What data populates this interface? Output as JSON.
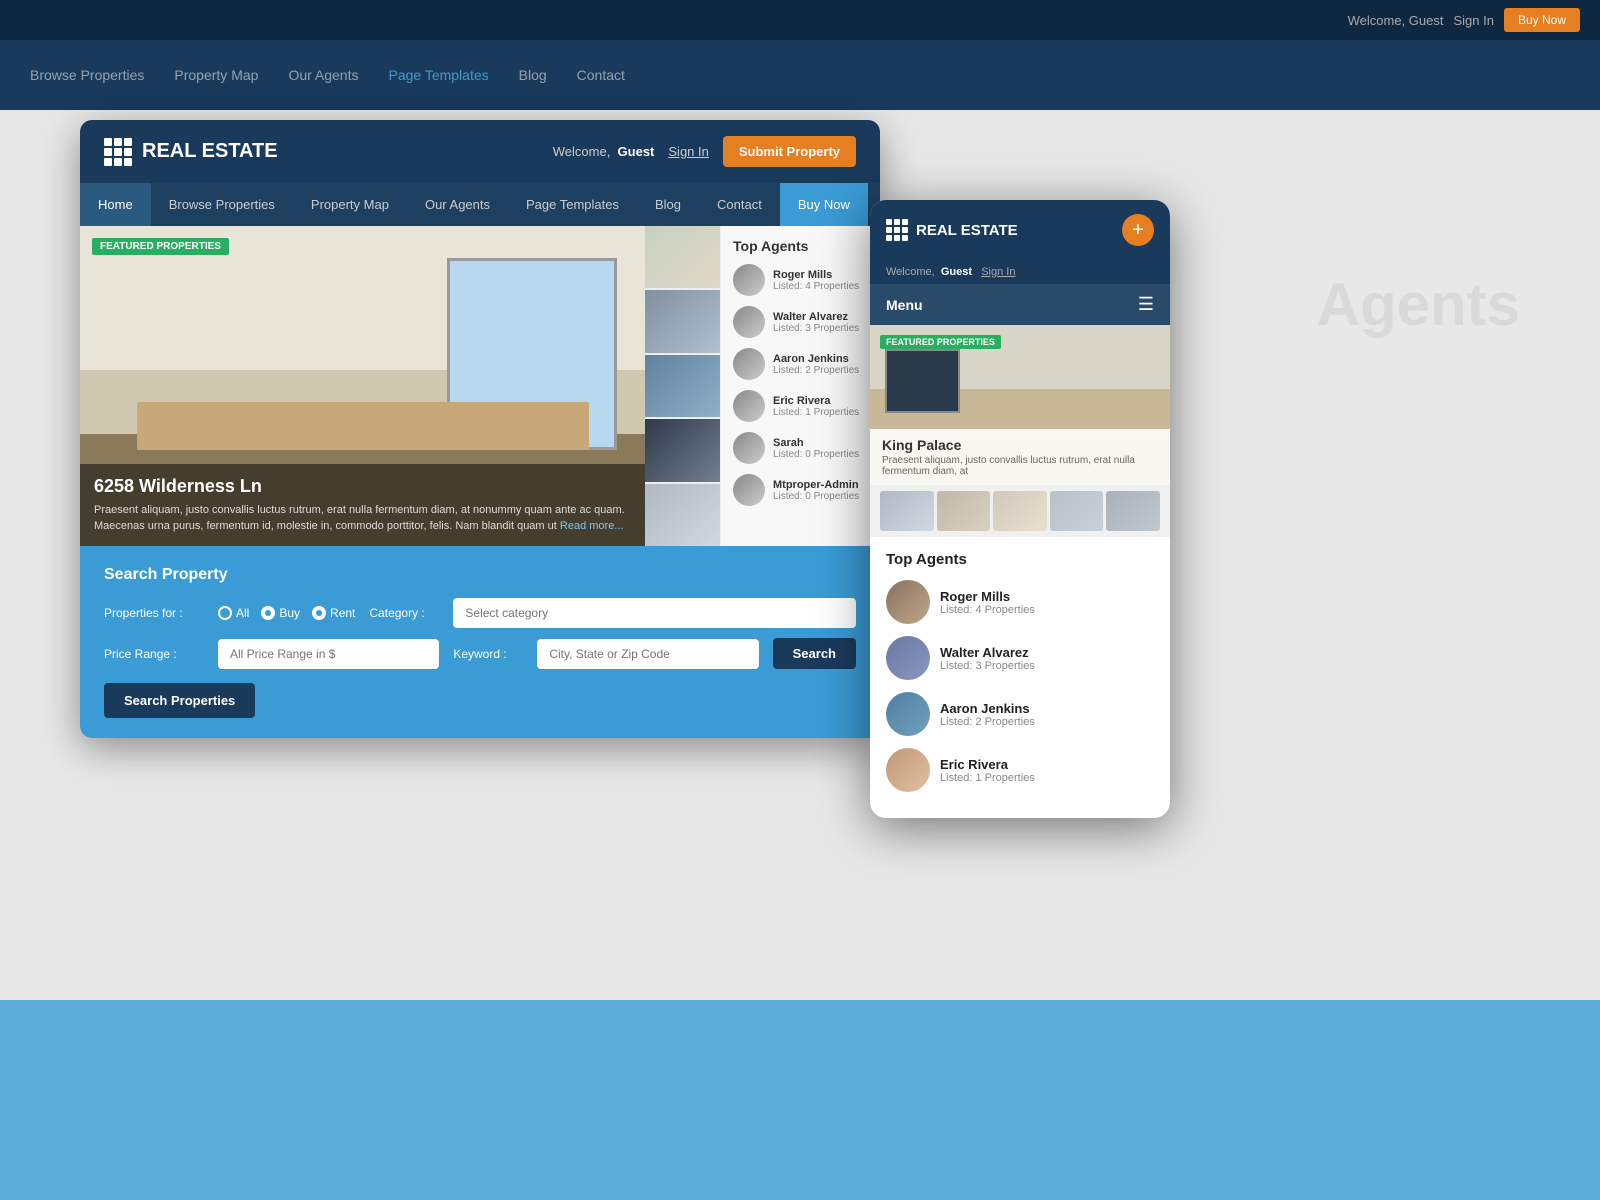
{
  "background": {
    "nav_items": [
      "Browse Properties",
      "Property Map",
      "Our Agents",
      "Page Templates",
      "Blog",
      "Contact"
    ],
    "buy_now": "Buy Now",
    "welcome": "Welcome, Guest",
    "sign_in": "Sign In",
    "heading": "Agents"
  },
  "desktop": {
    "logo": "REAL ESTATE",
    "welcome": "Welcome,",
    "guest": "Guest",
    "sign_in": "Sign In",
    "submit_btn": "Submit Property",
    "nav": {
      "home": "Home",
      "browse": "Browse Properties",
      "map": "Property Map",
      "agents": "Our Agents",
      "templates": "Page Templates",
      "blog": "Blog",
      "contact": "Contact",
      "buy": "Buy Now"
    },
    "featured_badge": "FEATURED PROPERTIES",
    "property_title": "6258 Wilderness Ln",
    "property_desc": "Praesent aliquam, justo convallis luctus rutrum, erat nulla fermentum diam, at nonummy quam ante ac quam. Maecenas urna purus, fermentum id, molestie in, commodo porttitor, felis. Nam blandit quam ut",
    "read_more": "Read more...",
    "agents": {
      "title": "Top Agents",
      "list": [
        {
          "name": "Roger Mills",
          "listed": "Listed: 4 Properties"
        },
        {
          "name": "Walter Alvarez",
          "listed": "Listed: 3 Properties"
        },
        {
          "name": "Aaron Jenkins",
          "listed": "Listed: 2 Properties"
        },
        {
          "name": "Eric Rivera",
          "listed": "Listed: 1 Properties"
        },
        {
          "name": "Sarah",
          "listed": "Listed: 0 Properties"
        },
        {
          "name": "Mtproper-Admin",
          "listed": "Listed: 0 Properties"
        }
      ]
    },
    "search": {
      "title": "Search Property",
      "properties_for": "Properties for :",
      "all": "All",
      "buy": "Buy",
      "rent": "Rent",
      "category_label": "Category :",
      "category_placeholder": "Select category",
      "price_label": "Price Range :",
      "price_placeholder": "All Price Range in $",
      "keyword_label": "Keyword :",
      "keyword_placeholder": "City, State or Zip Code",
      "search_btn": "Search",
      "search_properties_btn": "Search Properties"
    }
  },
  "mobile": {
    "logo": "REAL ESTATE",
    "welcome": "Welcome,",
    "guest": "Guest",
    "sign_in": "Sign In",
    "menu_label": "Menu",
    "featured_badge": "FEATURED PROPERTIES",
    "property_title": "King Palace",
    "property_desc": "Praesent aliquam, justo convallis luctus rutrum, erat nulla fermentum diam, at",
    "agents": {
      "title": "Top Agents",
      "list": [
        {
          "name": "Roger Mills",
          "listed": "Listed: 4 Properties"
        },
        {
          "name": "Walter Alvarez",
          "listed": "Listed: 3 Properties"
        },
        {
          "name": "Aaron Jenkins",
          "listed": "Listed: 2 Properties"
        },
        {
          "name": "Eric Rivera",
          "listed": "Listed: 1 Properties"
        }
      ]
    }
  }
}
